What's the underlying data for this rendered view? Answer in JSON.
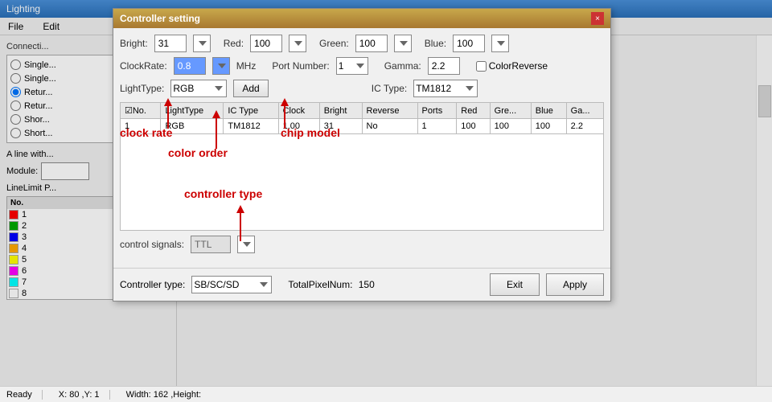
{
  "app": {
    "title": "Lighting",
    "menu": [
      "File",
      "Edit"
    ]
  },
  "dialog": {
    "title": "Controller setting",
    "close_btn": "×",
    "bright_label": "Bright:",
    "bright_value": "31",
    "red_label": "Red:",
    "red_value": "100",
    "green_label": "Green:",
    "green_value": "100",
    "blue_label": "Blue:",
    "blue_value": "100",
    "clockrate_label": "ClockRate:",
    "clockrate_value": "0.8",
    "clockrate_unit": "MHz",
    "port_number_label": "Port Number:",
    "port_number_value": "1",
    "gamma_label": "Gamma:",
    "gamma_value": "2.2",
    "color_reverse_label": "ColorReverse",
    "lighttype_label": "LightType:",
    "lighttype_value": "RGB",
    "add_btn": "Add",
    "ic_type_label": "IC Type:",
    "ic_type_value": "TM1812",
    "table": {
      "columns": [
        "No.",
        "LightType",
        "IC Type",
        "Clock",
        "Bright",
        "Reverse",
        "Ports",
        "Red",
        "Gre...",
        "Blue",
        "Ga..."
      ],
      "rows": [
        {
          "no": "1",
          "lighttype": "RGB",
          "ictype": "TM1812",
          "clock": "1.00",
          "bright": "31",
          "reverse": "No",
          "ports": "1",
          "red": "100",
          "green": "100",
          "blue": "100",
          "gamma": "2.2"
        }
      ]
    },
    "control_signals_label": "control signals:",
    "control_signals_value": "TTL",
    "controller_type_label": "Controller type:",
    "controller_type_value": "SB/SC/SD",
    "total_pixel_label": "TotalPixelNum:",
    "total_pixel_value": "150",
    "exit_btn": "Exit",
    "apply_btn": "Apply"
  },
  "annotations": {
    "clock_rate": "clock rate",
    "color_order": "color order",
    "chip_model": "chip model",
    "controller_type": "controller type"
  },
  "sidebar": {
    "connections_label": "Connecti...",
    "radio_items": [
      "Single...",
      "Single...",
      "Retur...",
      "Retur...",
      "Shor...",
      "Short..."
    ],
    "line_with": "A line with...",
    "module_label": "Module:",
    "line_limit": "LineLimit P...",
    "colors": [
      {
        "no": "1",
        "color": "#ff0000"
      },
      {
        "no": "2",
        "color": "#00aa00"
      },
      {
        "no": "3",
        "color": "#0000ff"
      },
      {
        "no": "4",
        "color": "#ffaa00"
      },
      {
        "no": "5",
        "color": "#ffff00"
      },
      {
        "no": "6",
        "color": "#ff00ff"
      },
      {
        "no": "7",
        "color": "#00ffff"
      },
      {
        "no": "8",
        "color": "#ffffff"
      }
    ]
  },
  "statusbar": {
    "ready": "Ready",
    "coords": "X: 80 ,Y: 1",
    "dimensions": "Width: 162 ,Height:"
  }
}
